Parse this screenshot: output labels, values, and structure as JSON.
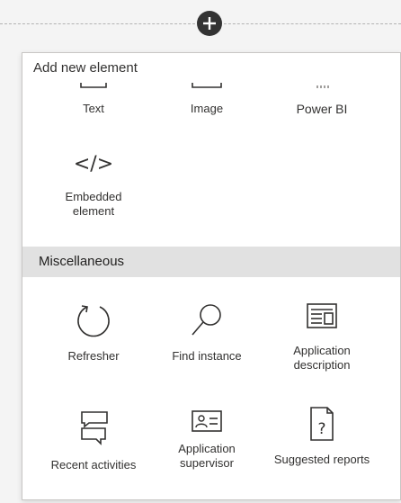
{
  "panel": {
    "title": "Add new element"
  },
  "top_tiles": [
    {
      "label": "Text",
      "icon": "text-icon"
    },
    {
      "label": "Image",
      "icon": "image-icon"
    },
    {
      "label": "Power BI",
      "icon": "power-bi-icon"
    }
  ],
  "embedded": {
    "label_line1": "Embedded",
    "label_line2": "element",
    "icon": "code-icon",
    "glyph": "</>"
  },
  "section": {
    "title": "Miscellaneous"
  },
  "misc_tiles": [
    {
      "label": "Refresher",
      "icon": "refresh-icon"
    },
    {
      "label": "Find instance",
      "icon": "search-icon"
    },
    {
      "label_line1": "Application",
      "label_line2": "description",
      "icon": "application-description-icon"
    },
    {
      "label": "Recent activities",
      "icon": "chat-icon"
    },
    {
      "label_line1": "Application",
      "label_line2": "supervisor",
      "icon": "contact-card-icon"
    },
    {
      "label": "Suggested reports",
      "icon": "document-question-icon"
    }
  ],
  "colors": {
    "add_button": "#333333",
    "section_bg": "#e1e1e1",
    "text": "#323130"
  }
}
